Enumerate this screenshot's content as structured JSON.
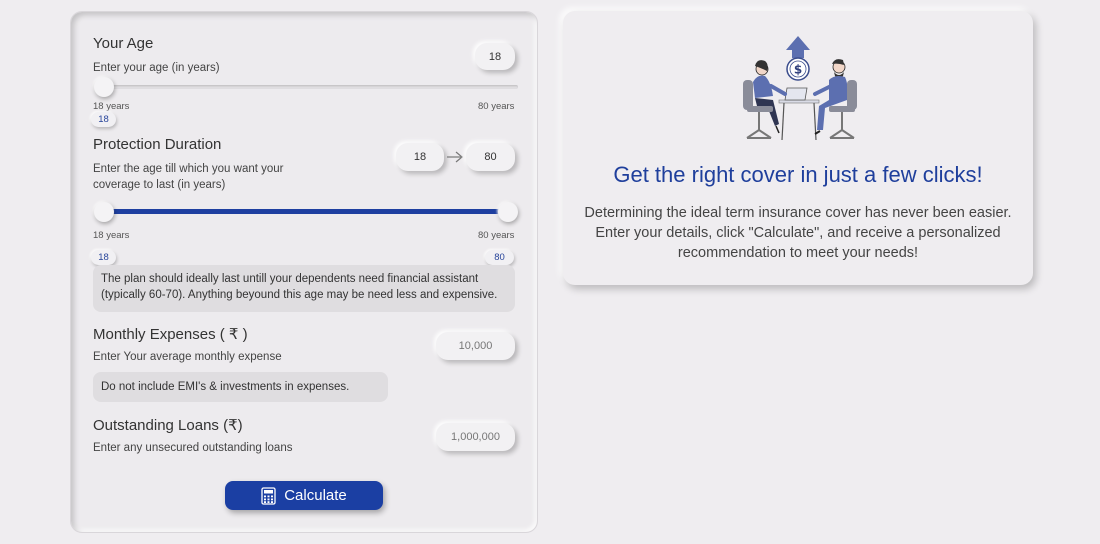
{
  "age": {
    "title": "Your Age",
    "subtitle": "Enter your age (in years)",
    "value": "18",
    "min_label": "18 years",
    "max_label": "80 years",
    "chip": "18"
  },
  "protection": {
    "title": "Protection Duration",
    "subtitle_line1": "Enter the age till which you want your",
    "subtitle_line2": "coverage to last (in years)",
    "from_value": "18",
    "to_value": "80",
    "min_label": "18 years",
    "max_label": "80 years",
    "chip_low": "18",
    "chip_high": "80",
    "note_line1": "The plan should ideally last untill your dependents need financial assistant",
    "note_line2": "(typically 60-70). Anything beyound this age may be need less and expensive."
  },
  "expenses": {
    "title": "Monthly Expenses",
    "currency": "( ₹ )",
    "subtitle": "Enter Your average monthly expense",
    "placeholder": "10,000",
    "note": "Do not include EMI's & investments in expenses."
  },
  "loans": {
    "title": "Outstanding Loans",
    "currency": "(₹)",
    "subtitle": "Enter any unsecured outstanding loans",
    "placeholder": "1,000,000"
  },
  "calculate_label": "Calculate",
  "info": {
    "headline": "Get the right cover in just a few clicks!",
    "desc_line1": "Determining the ideal term insurance cover has never been easier.",
    "desc_line2": "Enter your details, click \"Calculate\", and receive a personalized",
    "desc_line3": "recommendation to meet your needs!",
    "illustration": "business-meeting-illustration",
    "dollar_symbol": "$"
  },
  "colors": {
    "accent": "#1e3fa0",
    "background": "#efedf0"
  }
}
